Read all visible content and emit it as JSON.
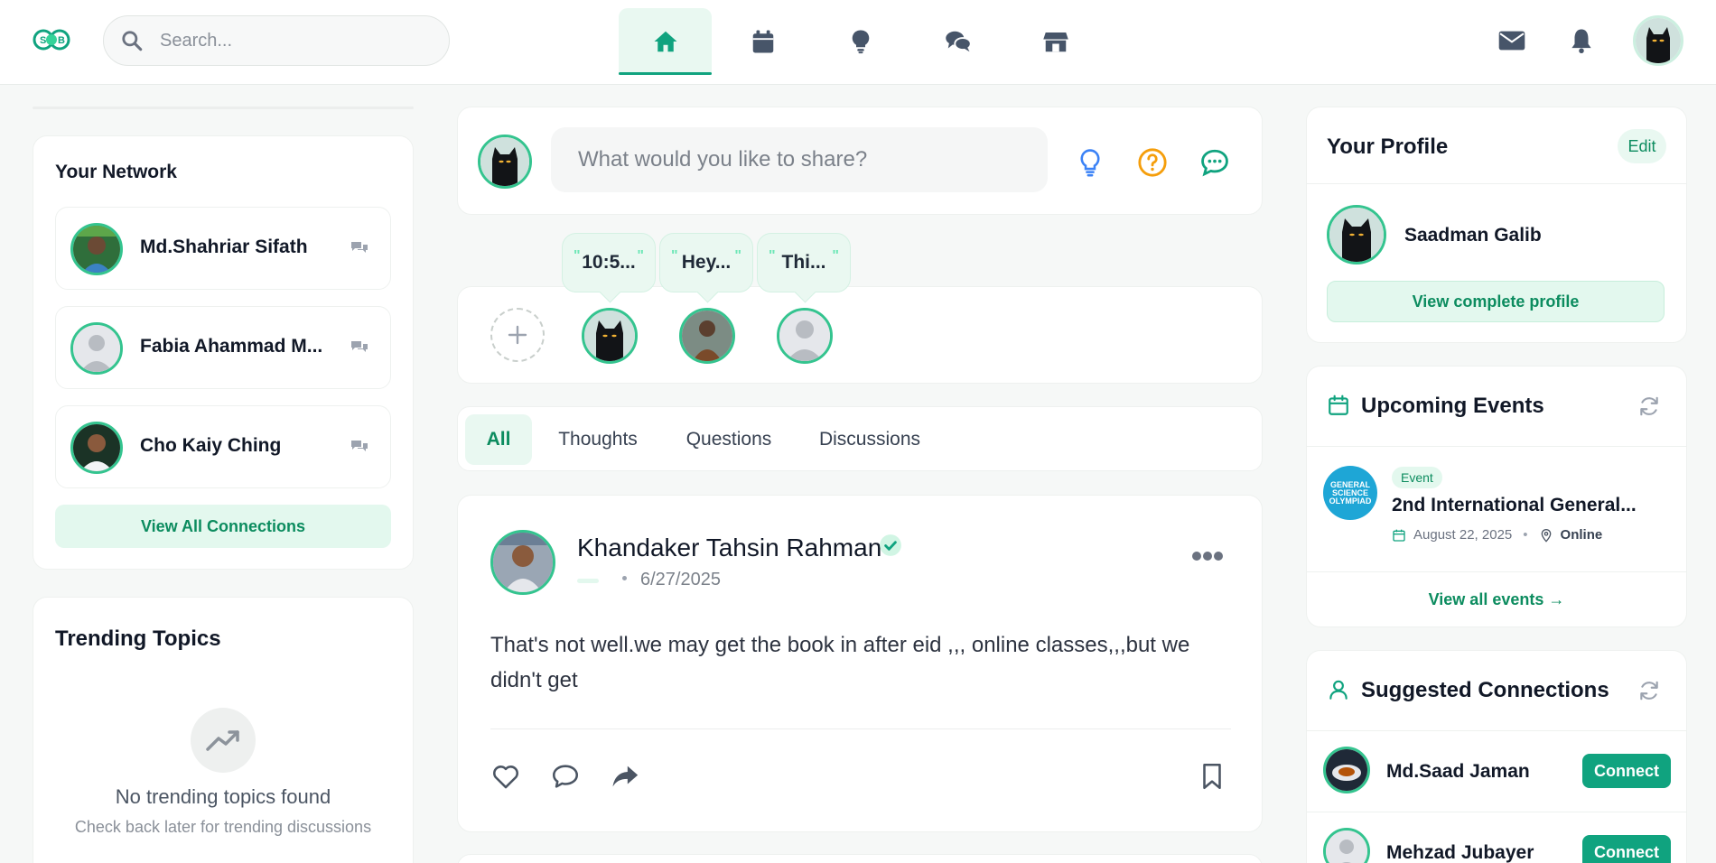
{
  "header": {
    "search_placeholder": "Search...",
    "logo_text": "S B",
    "nav": [
      {
        "name": "home",
        "icon": "home-icon",
        "active": true
      },
      {
        "name": "events",
        "icon": "calendar-icon",
        "active": false
      },
      {
        "name": "ideas",
        "icon": "lightbulb-icon",
        "active": false
      },
      {
        "name": "discussions",
        "icon": "chat-icon",
        "active": false
      },
      {
        "name": "marketplace",
        "icon": "store-icon",
        "active": false
      }
    ],
    "accent_color": "#10a37f"
  },
  "network": {
    "title": "Your Network",
    "items": [
      {
        "name": "Md.Shahriar Sifath"
      },
      {
        "name": "Fabia Ahammad M..."
      },
      {
        "name": "Cho Kaiy Ching"
      }
    ],
    "view_all": "View All Connections"
  },
  "trending": {
    "title": "Trending Topics",
    "empty_title": "No trending topics found",
    "empty_sub": "Check back later for trending discussions"
  },
  "composer": {
    "placeholder": "What would you like to share?"
  },
  "stories": {
    "bubbles": [
      "10:5...",
      "Hey...",
      "Thi..."
    ],
    "quote_open": "\"",
    "quote_close": "\""
  },
  "feed_tabs": {
    "items": [
      "All",
      "Thoughts",
      "Questions",
      "Discussions"
    ],
    "active": "All"
  },
  "post": {
    "author_first": "Khandaker Tahsin",
    "author_last": "Rahman",
    "date": "6/27/2025",
    "body": "That's not well.we may get the book in after eid ,,, online classes,,,but we didn't get"
  },
  "profile": {
    "title": "Your Profile",
    "edit": "Edit",
    "name": "Saadman Galib",
    "view_profile": "View complete profile"
  },
  "events": {
    "title": "Upcoming Events",
    "logo_lines": [
      "GENERAL",
      "SCIENCE",
      "OLYMPIAD"
    ],
    "badge": "Event",
    "event_title": "2nd International General...",
    "date": "August 22, 2025",
    "location": "Online",
    "view_all": "View all events"
  },
  "suggested": {
    "title": "Suggested Connections",
    "items": [
      {
        "name": "Md.Saad Jaman",
        "button": "Connect"
      },
      {
        "name": "Mehzad Jubayer",
        "button": "Connect"
      }
    ]
  }
}
